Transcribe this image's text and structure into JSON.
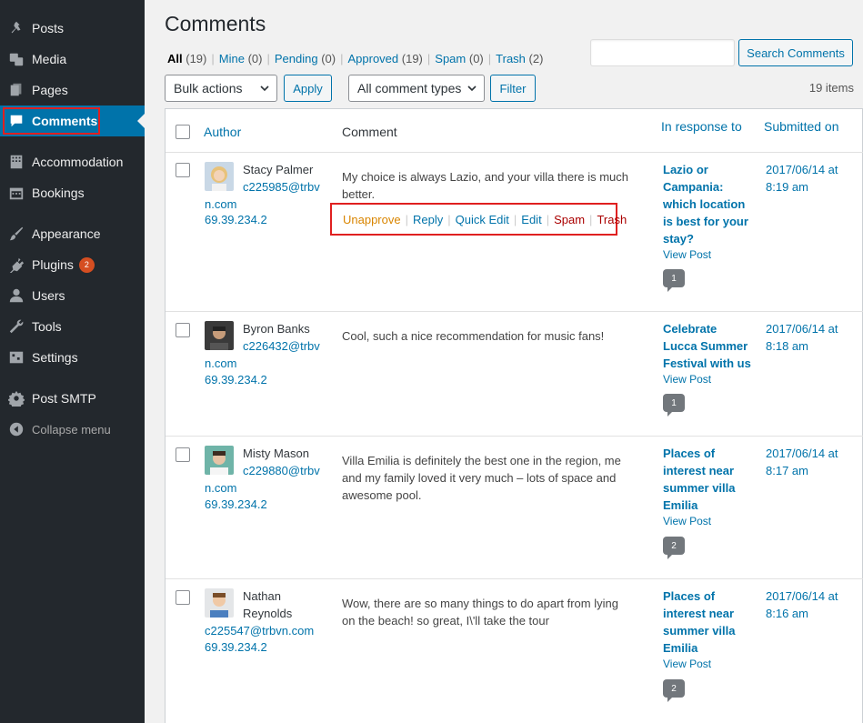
{
  "sidebar": {
    "items": [
      {
        "label": "Posts",
        "icon": "pin-icon"
      },
      {
        "label": "Media",
        "icon": "media-icon"
      },
      {
        "label": "Pages",
        "icon": "pages-icon"
      },
      {
        "label": "Comments",
        "icon": "comment-icon"
      },
      {
        "label": "Accommodation",
        "icon": "building-icon"
      },
      {
        "label": "Bookings",
        "icon": "calendar-icon"
      },
      {
        "label": "Appearance",
        "icon": "brush-icon"
      },
      {
        "label": "Plugins",
        "icon": "plugin-icon",
        "badge": "2"
      },
      {
        "label": "Users",
        "icon": "users-icon"
      },
      {
        "label": "Tools",
        "icon": "wrench-icon"
      },
      {
        "label": "Settings",
        "icon": "settings-icon"
      },
      {
        "label": "Post SMTP",
        "icon": "gear-icon"
      },
      {
        "label": "Collapse menu",
        "icon": "collapse-icon"
      }
    ]
  },
  "page": {
    "title": "Comments"
  },
  "filters": {
    "all": {
      "label": "All",
      "count": "(19)"
    },
    "mine": {
      "label": "Mine",
      "count": "(0)"
    },
    "pending": {
      "label": "Pending",
      "count": "(0)"
    },
    "approved": {
      "label": "Approved",
      "count": "(19)"
    },
    "spam": {
      "label": "Spam",
      "count": "(0)"
    },
    "trash": {
      "label": "Trash",
      "count": "(2)"
    },
    "separator": "|"
  },
  "search": {
    "value": "",
    "button_label": "Search Comments"
  },
  "bulk": {
    "selected": "Bulk actions",
    "apply_label": "Apply"
  },
  "types": {
    "selected": "All comment types",
    "filter_label": "Filter"
  },
  "items_count": "19 items",
  "table": {
    "headers": {
      "author": "Author",
      "comment": "Comment",
      "response": "In response to",
      "submitted": "Submitted on"
    }
  },
  "comments": [
    {
      "name": "Stacy Palmer",
      "email_1": "c225985@trbv",
      "email_2": "n.com",
      "ip": "69.39.234.2",
      "text": "My choice is always Lazio, and your villa there is much better.",
      "actions": [
        "Unapprove",
        "Reply",
        "Quick Edit",
        "Edit",
        "Spam",
        "Trash"
      ],
      "response": "Lazio or Campania: which location is best for your stay?",
      "view_post": "View Post",
      "count": "1",
      "date": "2017/06/14 at 8:19 am"
    },
    {
      "name": "Byron Banks",
      "email_1": "c226432@trbv",
      "email_2": "n.com",
      "ip": "69.39.234.2",
      "text": "Cool, such a nice recommendation for music fans!",
      "response": "Celebrate Lucca Summer Festival with us",
      "view_post": "View Post",
      "count": "1",
      "date": "2017/06/14 at 8:18 am"
    },
    {
      "name": "Misty Mason",
      "email_1": "c229880@trbv",
      "email_2": "n.com",
      "ip": "69.39.234.2",
      "text": "Villa Emilia is definitely the best one in the region, me and my family loved it very much – lots of space and awesome pool.",
      "response": "Places of interest near summer villa Emilia",
      "view_post": "View Post",
      "count": "2",
      "date": "2017/06/14 at 8:17 am"
    },
    {
      "name": "Nathan Reynolds",
      "email": "c225547@trbvn.com",
      "ip": "69.39.234.2",
      "text": "Wow, there are so many things to do apart from lying on the beach! so great, I\\'ll take the tour",
      "response": "Places of interest near summer villa Emilia",
      "view_post": "View Post",
      "count": "2",
      "date": "2017/06/14 at 8:16 am"
    }
  ],
  "colors": {
    "accent": "#0073aa",
    "sidebar": "#23282d",
    "highlight": "#e02020",
    "unapprove": "#d98500",
    "spam": "#a00"
  }
}
